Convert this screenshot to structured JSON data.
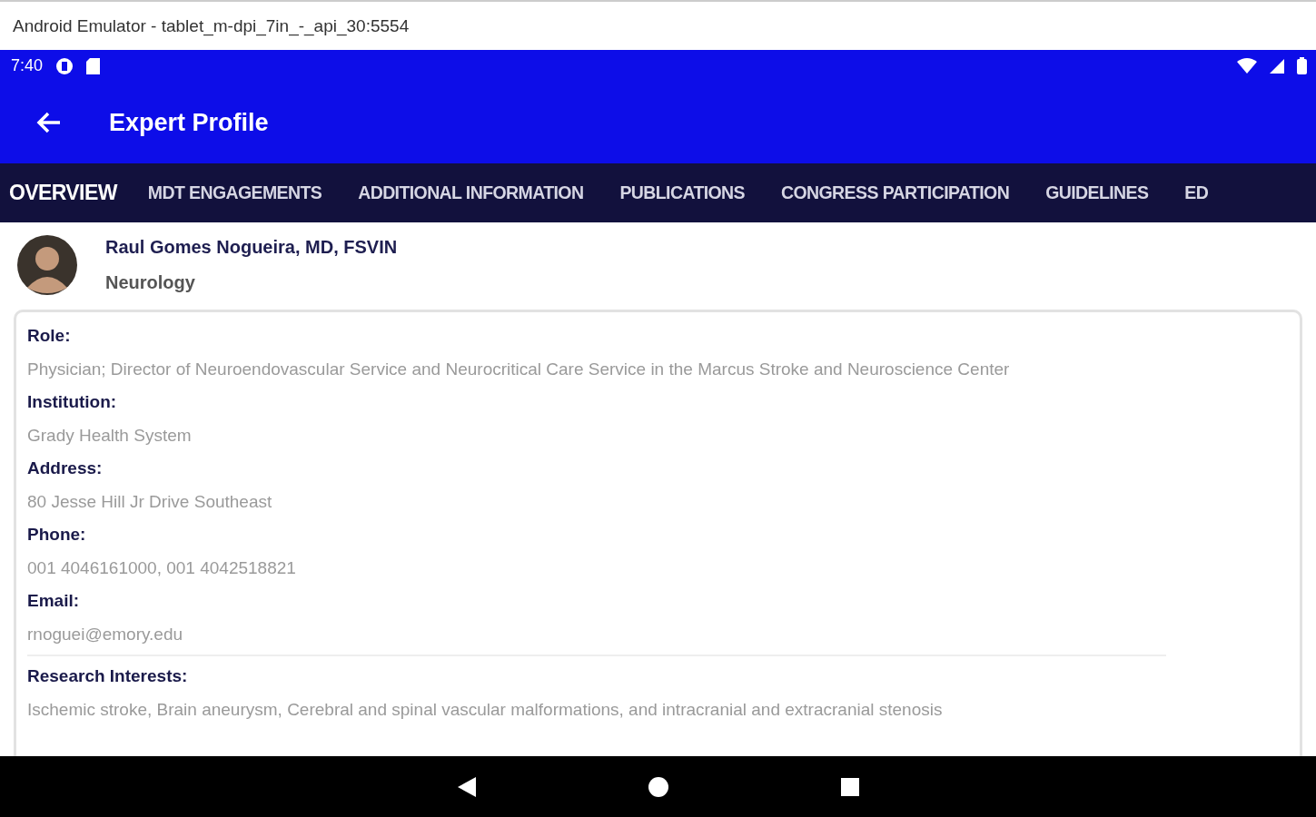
{
  "window": {
    "title": "Android Emulator - tablet_m-dpi_7in_-_api_30:5554"
  },
  "status_bar": {
    "time": "7:40"
  },
  "app_bar": {
    "title": "Expert Profile"
  },
  "tabs": [
    {
      "label": "OVERVIEW",
      "selected": true
    },
    {
      "label": "MDT ENGAGEMENTS",
      "selected": false
    },
    {
      "label": "ADDITIONAL INFORMATION",
      "selected": false
    },
    {
      "label": "PUBLICATIONS",
      "selected": false
    },
    {
      "label": "CONGRESS PARTICIPATION",
      "selected": false
    },
    {
      "label": "GUIDELINES",
      "selected": false
    },
    {
      "label": "ED",
      "selected": false
    }
  ],
  "profile": {
    "name": "Raul Gomes Nogueira, MD, FSVIN",
    "specialty": "Neurology"
  },
  "details": [
    {
      "label": "Role:",
      "value": "Physician; Director of Neuroendovascular Service and Neurocritical Care Service in the Marcus Stroke and Neuroscience Center"
    },
    {
      "label": "Institution:",
      "value": "Grady Health System"
    },
    {
      "label": "Address:",
      "value": "80 Jesse Hill Jr Drive Southeast"
    },
    {
      "label": "Phone:",
      "value": "001 4046161000, 001 4042518821"
    },
    {
      "label": "Email:",
      "value": "rnoguei@emory.edu"
    }
  ],
  "research": {
    "label": "Research Interests:",
    "value": "Ischemic stroke, Brain aneurysm, Cerebral and spinal vascular malformations, and intracranial and extracranial stenosis"
  }
}
